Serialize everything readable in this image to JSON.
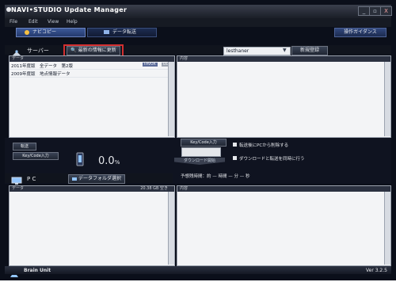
{
  "window": {
    "title": "NAVI•STUDIO  Update Manager",
    "controls": [
      "_",
      "▫",
      "X"
    ]
  },
  "menu": [
    "File",
    "Edit",
    "View",
    "Help"
  ],
  "tabs": [
    {
      "label": "ナビコピー"
    },
    {
      "label": "データ転送"
    }
  ],
  "guide_button": "操作ガイダンス",
  "server": {
    "label": "サーバー",
    "fetch_button": "最新の情報に更新",
    "select_value": "lesthaner",
    "register_button": "新規登録",
    "list_header": "データ",
    "detail_header": "内容",
    "items": [
      {
        "label": "2011年度版　全データ　第2版",
        "badge": "FAVOR",
        "badge2": "DL"
      },
      {
        "label": "2009年度版　地点情報データ"
      }
    ]
  },
  "middle": {
    "left_chip": "転送",
    "left_chip2": "Key/Code入力",
    "progress_value": "0.0",
    "progress_unit": "%",
    "keycode_label": "Key/Code入力",
    "download_button": "ダウンロード開始",
    "check1": "転送後にPCから削除する",
    "check2": "ダウンロードと転送を同時に行う",
    "remaining_label": "予想残時間：約 — 時間 — 分 — 秒"
  },
  "pc": {
    "label": "P C",
    "folder_button": "データフォルダ選択",
    "list_header": "データ",
    "list_info": "20.38 GB 空き",
    "detail_header": "内容"
  },
  "status": {
    "unit_label": "Brain Unit",
    "version": "Ver 3.2.5"
  },
  "accent": {
    "highlight_border": "#d32f2f",
    "panel_header": "#2b3140",
    "tab_active": "#2f4a86"
  }
}
